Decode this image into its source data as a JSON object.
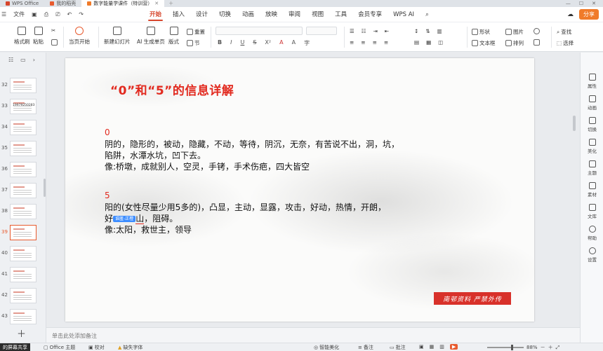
{
  "tabs": [
    {
      "label": "WPS Office",
      "color": "#d6452b"
    },
    {
      "label": "我的稻壳",
      "color": "#e85b2f"
    },
    {
      "label": "数字能量学课件（特训营）",
      "color": "#f07b2a",
      "active": true
    }
  ],
  "menu": {
    "file": "文件",
    "tabs": [
      "开始",
      "插入",
      "设计",
      "切换",
      "动画",
      "放映",
      "审阅",
      "视图",
      "工具",
      "会员专享",
      "WPS AI"
    ],
    "active_tab": "开始",
    "share": "分享"
  },
  "ribbon": {
    "format_painter": "格式刷",
    "paste": "粘贴",
    "start_from_current": "当页开始",
    "new_slide": "新建幻灯片",
    "ai_single": "AI 生成单页",
    "layout": "版式",
    "reset": "重置",
    "section": "节",
    "shape": "形状",
    "picture": "图片",
    "textbox": "文本框",
    "arrange": "排列",
    "find": "查找",
    "select": "选择"
  },
  "thumbnails": {
    "numbers": [
      "32",
      "33",
      "34",
      "35",
      "36",
      "37",
      "38",
      "39",
      "40",
      "41",
      "42",
      "43"
    ],
    "active": "39",
    "thumb33_text": "19979250283"
  },
  "slide": {
    "title": "“0”和“5”的信息详解",
    "sec0": {
      "num": "0",
      "line1": "阴的，隐形的，被动，隐藏，不动，等待，阴沉，无奈，有苦说不出，洞，坑，",
      "line2": "陷阱，水潭水坑，凹下去。",
      "line3": "像:桥墩，成就别人，空灵，手铐，手术伤疤，四大皆空"
    },
    "sec5": {
      "num": "5",
      "line1": "阳的(女性尽量少用5多的)，凸显，主动，显露，攻击，好动，热情，开朗，",
      "line2_prefix": "好",
      "badge": "谁匿-正橙",
      "line2_mid": "山",
      "line2_suffix": "，阻碍。",
      "line3": "像:太阳，救世主，领导"
    },
    "stamp": "南邨资料 严禁外传"
  },
  "notes_placeholder": "单击此处添加备注",
  "sidepane": [
    "属性",
    "动画",
    "切换",
    "美化",
    "主题",
    "素材",
    "文库",
    "帮助",
    "设置"
  ],
  "status": {
    "screenshare": "的屏幕共享",
    "office_theme": "Office 主题",
    "proofread": "校对",
    "missing_font": "缺失字体",
    "smart_beautify": "智能美化",
    "notes": "备注",
    "comments": "批注",
    "zoom": "88%"
  }
}
